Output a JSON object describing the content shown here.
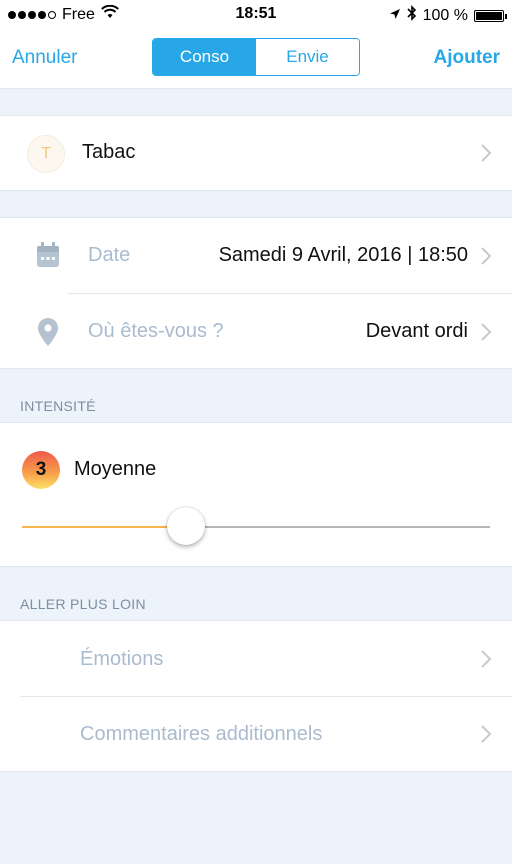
{
  "status_bar": {
    "carrier": "Free",
    "time": "18:51",
    "battery": "100 %",
    "signal_bars_filled": 4,
    "signal_bars_total": 5
  },
  "navbar": {
    "cancel_label": "Annuler",
    "add_label": "Ajouter",
    "segments": [
      "Conso",
      "Envie"
    ],
    "selected_segment": "Conso"
  },
  "substance": {
    "initial": "T",
    "label": "Tabac"
  },
  "details": {
    "date_label": "Date",
    "date_value": "Samedi 9 Avril, 2016 | 18:50",
    "location_label": "Où êtes-vous ?",
    "location_value": "Devant ordi"
  },
  "intensity": {
    "header": "INTENSITÉ",
    "level": "3",
    "level_label": "Moyenne",
    "slider_fraction": 0.35
  },
  "more": {
    "header": "ALLER PLUS LOIN",
    "emotions_label": "Émotions",
    "comments_label": "Commentaires additionnels"
  },
  "colors": {
    "accent": "#27a7e7",
    "background": "#edf3fa",
    "placeholder": "#a9bccf",
    "slider_fill": "#f6b54d"
  }
}
